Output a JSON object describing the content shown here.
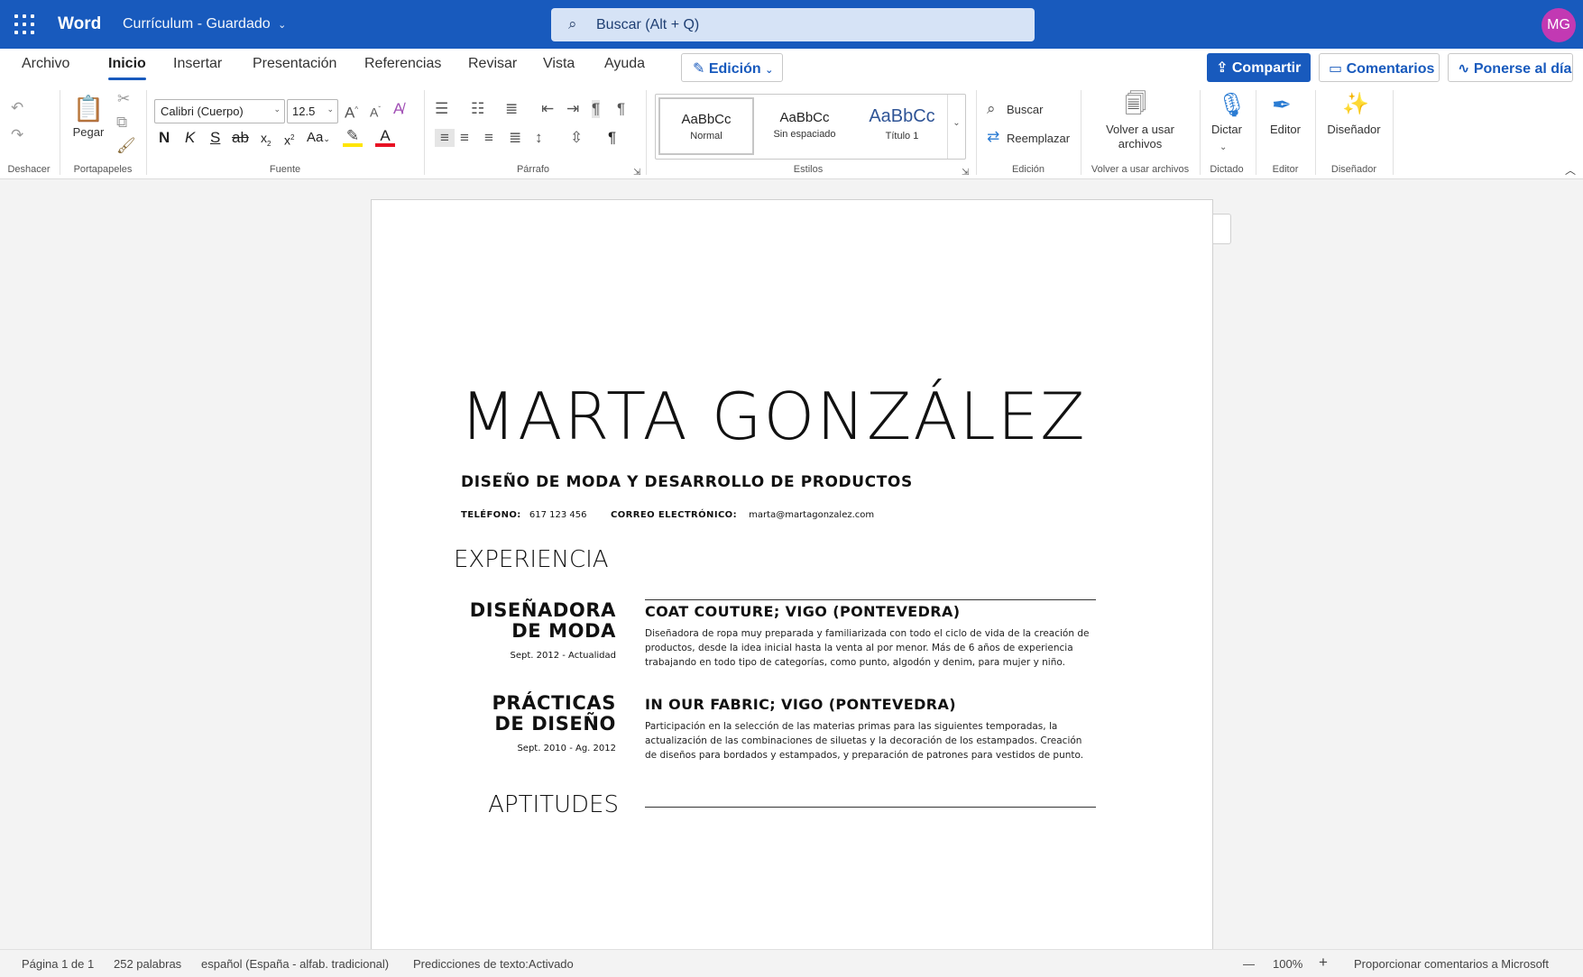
{
  "app": {
    "name": "Word",
    "doc_title": "Currículum",
    "save_state": "Guardado",
    "search_placeholder": "Buscar (Alt + Q)",
    "user_initials": "MG"
  },
  "tabs": [
    "Archivo",
    "Inicio",
    "Insertar",
    "Presentación",
    "Referencias",
    "Revisar",
    "Vista",
    "Ayuda"
  ],
  "mode": "Edición",
  "actions": {
    "share": "Compartir",
    "comments": "Comentarios",
    "catch_up": "Ponerse al día"
  },
  "ribbon": {
    "groups": {
      "undo": "Deshacer",
      "clipboard": "Portapapeles",
      "font": "Fuente",
      "paragraph": "Párrafo",
      "styles": "Estilos",
      "editing": "Edición",
      "reuse": "Volver a usar archivos",
      "dictation": "Dictado",
      "editor": "Editor",
      "designer": "Diseñador"
    },
    "paste": "Pegar",
    "font_name": "Calibri (Cuerpo)",
    "font_size": "12.5",
    "bold": "N",
    "italic": "K",
    "underline": "S",
    "strike": "ab",
    "subscript": "x",
    "superscript": "x",
    "change_case": "Aa",
    "styles": [
      {
        "sample": "AaBbCc",
        "name": "Normal"
      },
      {
        "sample": "AaBbCc",
        "name": "Sin espaciado"
      },
      {
        "sample": "AaBbCc",
        "name": "Título 1"
      }
    ],
    "find": "Buscar",
    "replace": "Reemplazar",
    "reuse_line1": "Volver a usar",
    "reuse_line2": "archivos",
    "dictate": "Dictar",
    "editor_btn": "Editor",
    "designer_btn": "Diseñador"
  },
  "colors": {
    "brand": "#185abd",
    "avatar": "#c239b3",
    "highlight": "#ffe500",
    "font_color": "#e81123"
  },
  "resume": {
    "name": "MARTA GONZÁLEZ",
    "role": "DISEÑO DE MODA Y DESARROLLO DE PRODUCTOS",
    "phone_label": "TELÉFONO:",
    "phone": "617 123 456",
    "email_label": "CORREO ELECTRÓNICO:",
    "email": "marta@martagonzalez.com",
    "experience_heading": "EXPERIENCIA",
    "jobs": [
      {
        "title_line1": "DISEÑADORA",
        "title_line2": "DE MODA",
        "dates": "Sept. 2012 - Actualidad",
        "company": "COAT COUTURE; VIGO (PONTEVEDRA)",
        "desc": "Diseñadora de ropa muy preparada y familiarizada con todo el ciclo de vida de la creación de productos, desde la idea inicial hasta la venta al por menor. Más de 6 años de experiencia trabajando en todo tipo de categorías, como punto, algodón y denim, para mujer y niño."
      },
      {
        "title_line1": "PRÁCTICAS",
        "title_line2": "DE DISEÑO",
        "dates": "Sept. 2010 - Ag. 2012",
        "company": "IN OUR FABRIC; VIGO (PONTEVEDRA)",
        "desc": "Participación en la selección de las materias primas para las siguientes temporadas, la actualización de las combinaciones de siluetas y la decoración de los estampados. Creación de diseños para bordados y estampados, y preparación de patrones para vestidos de punto."
      }
    ],
    "skills_heading": "APTITUDES"
  },
  "status": {
    "page": "Página 1 de 1",
    "words": "252 palabras",
    "language": "español (España - alfab. tradicional)",
    "predictions": "Predicciones de texto:Activado",
    "zoom_out": "—",
    "zoom": "100%",
    "zoom_in": "+",
    "feedback": "Proporcionar comentarios a Microsoft"
  }
}
